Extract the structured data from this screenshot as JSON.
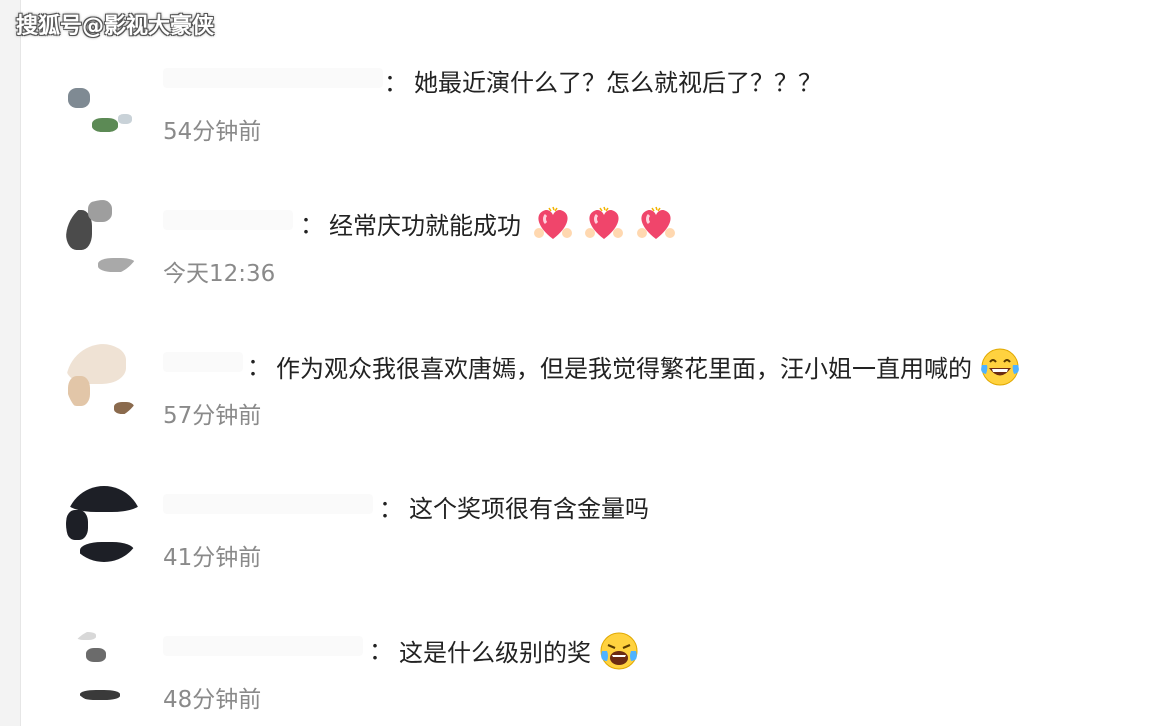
{
  "watermark": "搜狐号@影视大豪侠",
  "comments": [
    {
      "separator": "：",
      "text": "她最近演什么了？怎么就视后了？？？",
      "time": "54分钟前"
    },
    {
      "separator": "：",
      "text": "经常庆功就能成功",
      "time": "今天12:36",
      "emojis": [
        "heart-hands-emoji",
        "heart-hands-emoji",
        "heart-hands-emoji"
      ]
    },
    {
      "separator": "：",
      "text": "作为观众我很喜欢唐嫣，但是我觉得繁花里面，汪小姐一直用喊的",
      "time": "57分钟前",
      "emojis": [
        "laughing-tears-emoji"
      ]
    },
    {
      "separator": "：",
      "text": "这个奖项很有含金量吗",
      "time": "41分钟前"
    },
    {
      "separator": "：",
      "text": "这是什么级别的奖",
      "time": "48分钟前",
      "emojis": [
        "crying-laughing-emoji"
      ]
    }
  ],
  "colors": {
    "text": "#222222",
    "time": "#8a8a8a",
    "heart": "#f0456b"
  }
}
